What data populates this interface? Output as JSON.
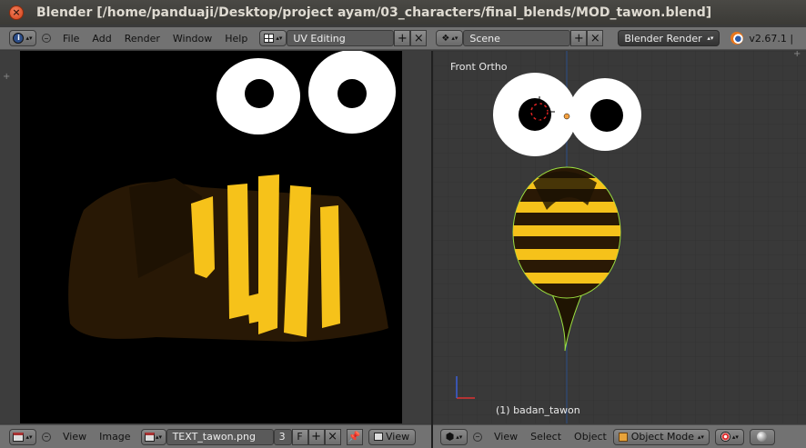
{
  "window": {
    "title": "Blender [/home/panduaji/Desktop/project ayam/03_characters/final_blends/MOD_tawon.blend]",
    "close_glyph": "×"
  },
  "top_header": {
    "menus": [
      "File",
      "Add",
      "Render",
      "Window",
      "Help"
    ],
    "screen_layout": "UV Editing",
    "scene": "Scene",
    "render_engine": "Blender Render",
    "version": "v2.67.1 |"
  },
  "uv_editor": {
    "menus": [
      "View",
      "Image"
    ],
    "image_name": "TEXT_tawon.png",
    "users_count": "3",
    "fake_user": "F",
    "view_menu": "View"
  },
  "viewport": {
    "view_name": "Front Ortho",
    "object_label": "(1) badan_tawon",
    "menus": [
      "View",
      "Select",
      "Object"
    ],
    "mode": "Object Mode"
  },
  "colors": {
    "header": "#727272",
    "viewport_bg": "#393939",
    "bee_yellow": "#f6c21a",
    "bee_dark": "#2a1905",
    "select_outline": "#9be040"
  },
  "icons": {
    "info": "info-icon",
    "layout": "layout-icon",
    "scene": "scene-icon",
    "render": "blender-logo-icon",
    "image_editor": "image-editor-icon",
    "image_browse": "image-browse-icon",
    "pin": "pin-icon",
    "view3d": "view3d-cube-icon",
    "object_mode": "object-mode-icon",
    "shading": "sphere-shading-icon"
  }
}
